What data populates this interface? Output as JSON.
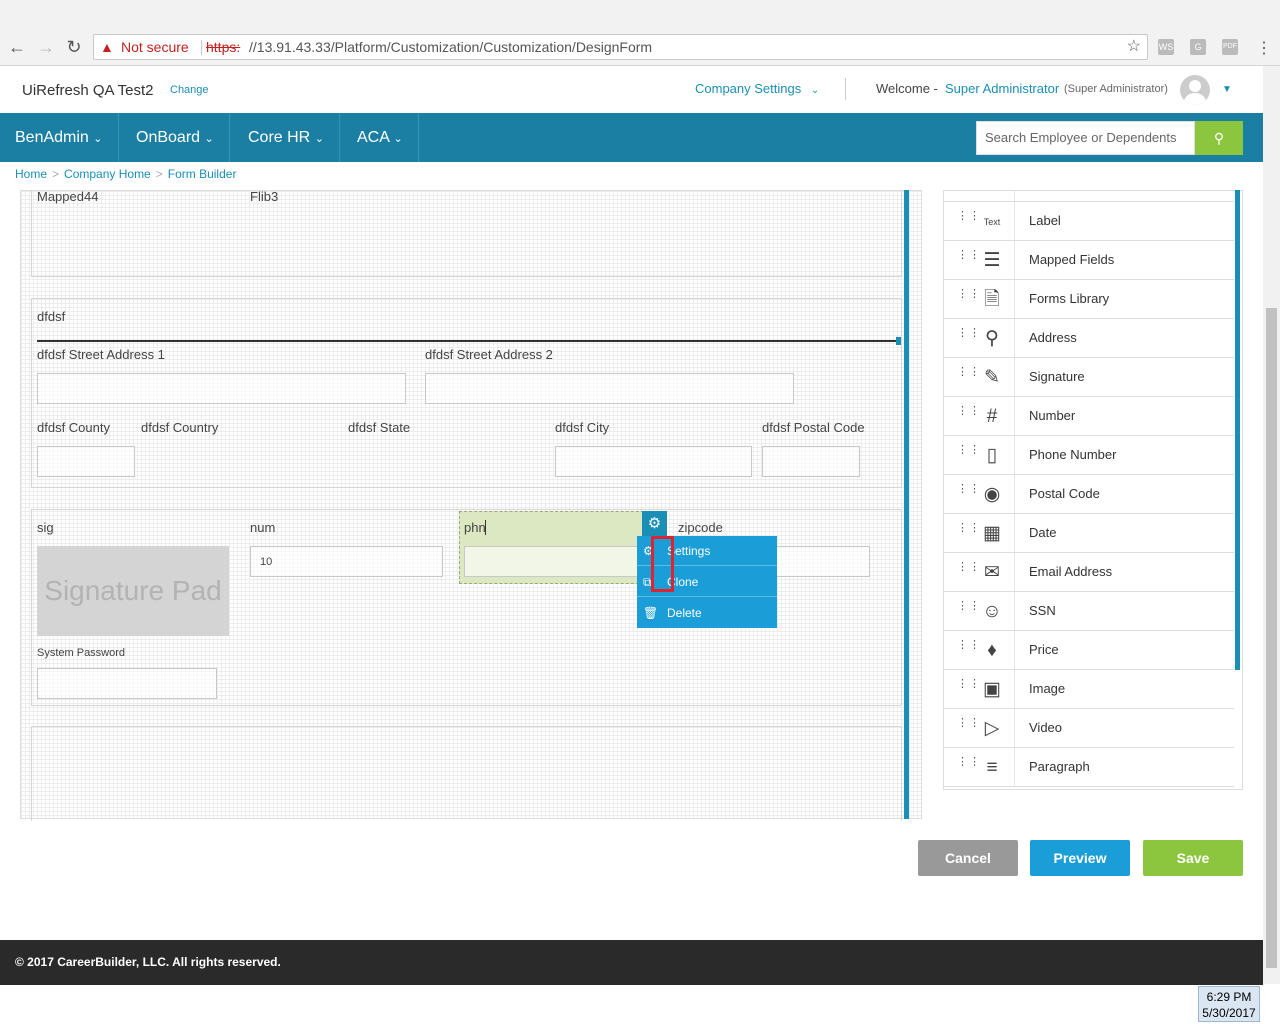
{
  "browser": {
    "security_label": "Not secure",
    "url_protocol": "https:",
    "url_rest": "//13.91.43.33/Platform/Customization/Customization/DesignForm",
    "ext_icons": [
      "WS",
      "G",
      "PDF"
    ]
  },
  "header": {
    "company": "UiRefresh QA Test2",
    "change_link": "Change",
    "company_settings": "Company Settings",
    "welcome": "Welcome -",
    "user_name": "Super Administrator",
    "user_role": "(Super Administrator)"
  },
  "nav": {
    "items": [
      "BenAdmin",
      "OnBoard",
      "Core HR",
      "ACA"
    ],
    "search_placeholder": "Search Employee or Dependents"
  },
  "breadcrumb": [
    "Home",
    "Company Home",
    "Form Builder"
  ],
  "form": {
    "section1": {
      "labels": [
        "Mapped44",
        "Flib3"
      ]
    },
    "section2": {
      "title": "dfdsf",
      "street1": "dfdsf Street Address 1",
      "street2": "dfdsf Street Address 2",
      "county": "dfdsf County",
      "country": "dfdsf Country",
      "state": "dfdsf State",
      "city": "dfdsf City",
      "postal": "dfdsf Postal Code"
    },
    "section3": {
      "sig_label": "sig",
      "signature_pad": "Signature Pad",
      "num_label": "num",
      "num_value": "10",
      "phn_label": "phn",
      "zipcode_label": "zipcode",
      "system_password": "System Password"
    },
    "context_menu": [
      "Settings",
      "Clone",
      "Delete"
    ]
  },
  "panel": {
    "items": [
      {
        "label": "Label",
        "icon": "text-label-icon"
      },
      {
        "label": "Mapped Fields",
        "icon": "mapped-fields-icon"
      },
      {
        "label": "Forms Library",
        "icon": "forms-library-icon"
      },
      {
        "label": "Address",
        "icon": "map-pin-icon"
      },
      {
        "label": "Signature",
        "icon": "signature-icon"
      },
      {
        "label": "Number",
        "icon": "hash-icon"
      },
      {
        "label": "Phone Number",
        "icon": "phone-icon"
      },
      {
        "label": "Postal Code",
        "icon": "postal-pin-icon"
      },
      {
        "label": "Date",
        "icon": "calendar-icon"
      },
      {
        "label": "Email Address",
        "icon": "envelope-icon"
      },
      {
        "label": "SSN",
        "icon": "person-icon"
      },
      {
        "label": "Price",
        "icon": "price-tag-icon"
      },
      {
        "label": "Image",
        "icon": "image-icon"
      },
      {
        "label": "Video",
        "icon": "video-icon"
      },
      {
        "label": "Paragraph",
        "icon": "paragraph-icon"
      }
    ]
  },
  "actions": {
    "cancel": "Cancel",
    "preview": "Preview",
    "save": "Save"
  },
  "footer": "© 2017 CareerBuilder, LLC. All rights reserved.",
  "taskbar": {
    "time": "6:29 PM",
    "date": "5/30/2017"
  },
  "colors": {
    "primary": "#1b7fa3",
    "accent": "#1b9ed8",
    "success": "#8cc63f",
    "highlight": "#e0232e"
  }
}
